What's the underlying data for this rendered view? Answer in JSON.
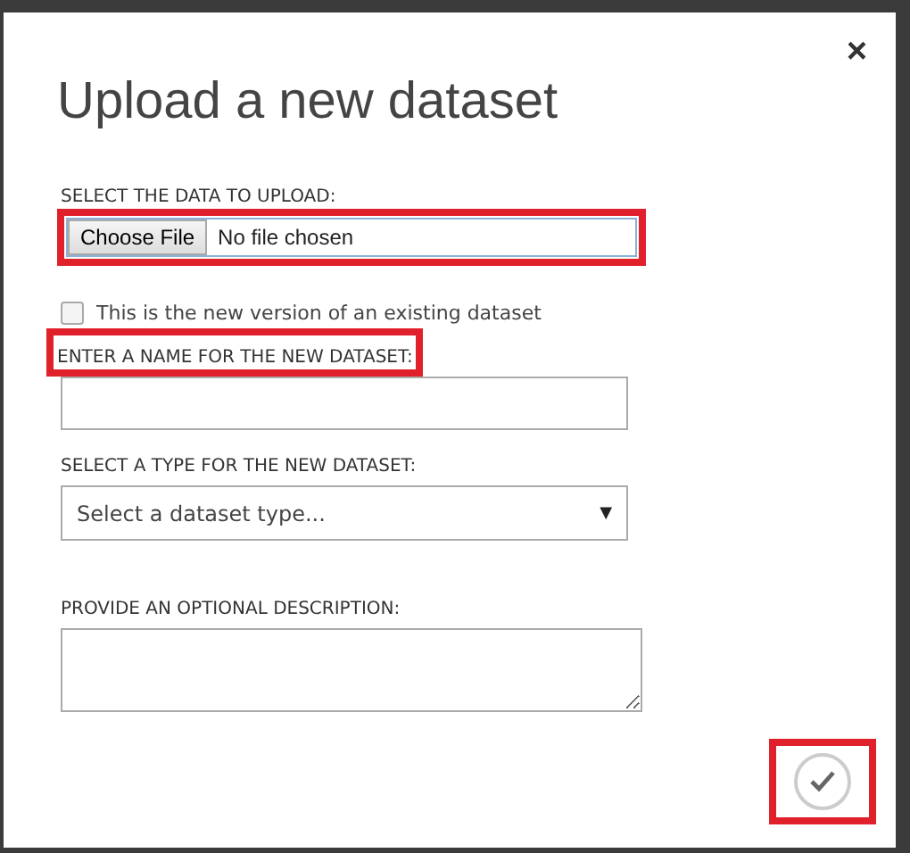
{
  "dialog": {
    "title": "Upload a new dataset",
    "close": "×"
  },
  "file_upload": {
    "label": "SELECT THE DATA TO UPLOAD:",
    "button": "Choose File",
    "status": "No file chosen",
    "highlighted": true
  },
  "new_version": {
    "label": "This is the new version of an existing dataset",
    "checked": false
  },
  "name": {
    "label": "ENTER A NAME FOR THE NEW DATASET:",
    "highlighted": true
  },
  "type": {
    "label": "SELECT A TYPE FOR THE NEW DATASET:",
    "placeholder": "Select a dataset type...",
    "arrow": "▼"
  },
  "description": {
    "label": "PROVIDE AN OPTIONAL DESCRIPTION:"
  },
  "confirm": {
    "highlighted": true
  }
}
